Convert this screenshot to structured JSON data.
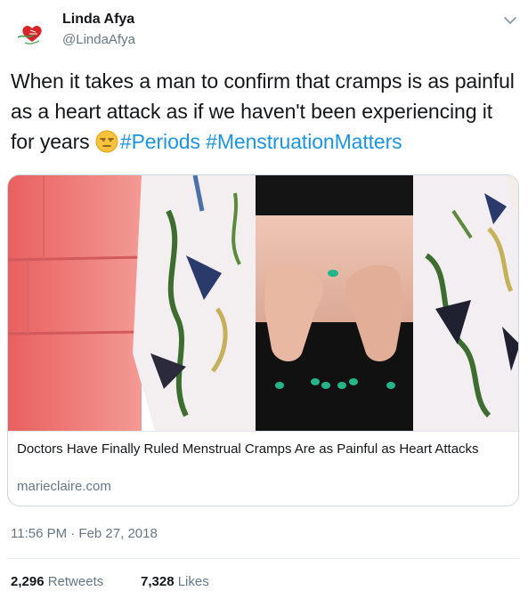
{
  "author": {
    "display_name": "Linda Afya",
    "handle": "@LindaAfya",
    "avatar_icon": "red-heart-logo-icon"
  },
  "menu": {
    "icon": "chevron-down-icon"
  },
  "tweet": {
    "text_before": "When it takes a man to confirm that cramps is as painful as a heart attack as if we haven't been experiencing it for years ",
    "emoji_icon": "unamused-face-emoji-icon",
    "hashtags": [
      "#Periods",
      "#MenstruationMatters"
    ]
  },
  "card": {
    "title": "Doctors Have Finally Ruled Menstrual Cramps Are as Painful as Heart Attacks",
    "domain": "marieclaire.com"
  },
  "timestamp": "11:56 PM · Feb 27, 2018",
  "stats": {
    "retweets_count": "2,296",
    "retweets_label": "Retweets",
    "likes_count": "7,328",
    "likes_label": "Likes"
  },
  "colors": {
    "link": "#1b95e0",
    "secondary_text": "#657786",
    "border": "#ccd6dd"
  }
}
